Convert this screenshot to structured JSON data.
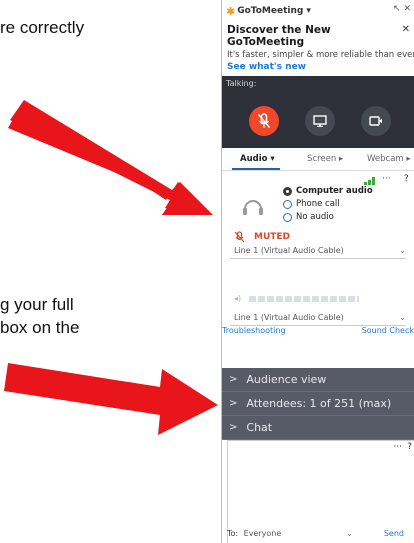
{
  "slide": {
    "line1": "re correctly",
    "line2": "g your full",
    "line3": "box on the"
  },
  "colors": {
    "arrow": "#e8161a",
    "muted": "#e8421c",
    "link": "#1b7bd8",
    "navbar": "#575b66",
    "dark_panel": "#2d3038"
  },
  "app": {
    "title": "GoToMeeting",
    "title_arrow": "▾",
    "window_controls": "↖ ✕"
  },
  "banner": {
    "title": "Discover the New GoToMeeting",
    "text": "It's faster, simpler & more reliable than ever",
    "link": "See what's new",
    "close": "✕"
  },
  "talking_label": "Talking:",
  "tabs": [
    {
      "label": "Audio ▾"
    },
    {
      "label": "Screen ▸"
    },
    {
      "label": "Webcam ▸"
    }
  ],
  "audio": {
    "options": [
      "Computer audio",
      "Phone call",
      "No audio"
    ],
    "selected": "Computer audio",
    "muted_label": "MUTED",
    "mic_device": "Line 1 (Virtual Audio Cable)",
    "speaker_device": "Line 1 (Virtual Audio Cable)",
    "troubleshooting": "Troubleshooting",
    "sound_check": "Sound Check",
    "more": "···",
    "help": "?"
  },
  "nav": [
    "Audience view",
    "Attendees:  1 of 251 (max)",
    "Chat"
  ],
  "chat": {
    "more": "···",
    "help": "?",
    "to_label": "To:",
    "recipient": "Everyone",
    "send": "Send"
  }
}
